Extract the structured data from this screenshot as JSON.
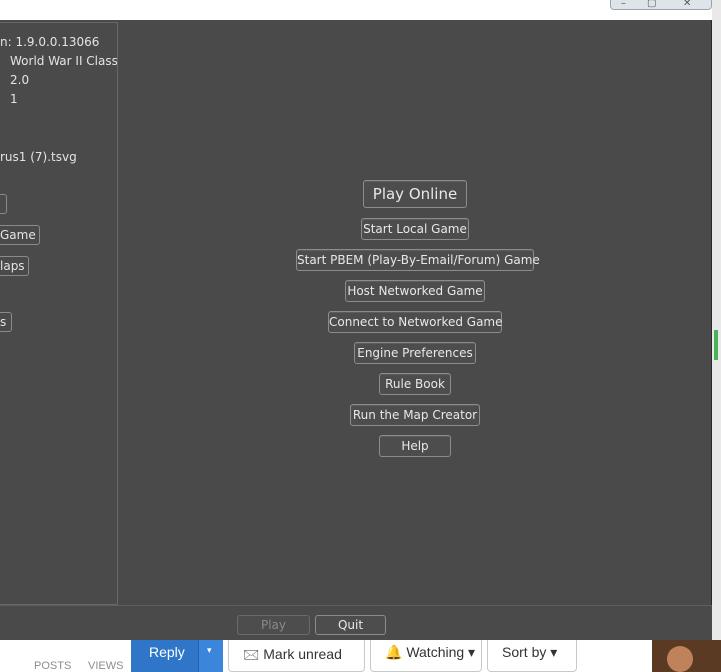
{
  "background": {
    "stats": [
      "POSTS",
      "VIEWS"
    ],
    "reply_label": "Reply",
    "reply_dropdown_glyph": "▾",
    "mark_unread_label": "🖂 Mark unread",
    "watching_label": "🔔 Watching ▾",
    "sort_by_label": "Sort by ▾",
    "window_controls": [
      "–",
      "▢",
      "✕"
    ]
  },
  "info": {
    "engine_version": "n:  1.9.0.0.13066",
    "game_name": "World War II Classic",
    "game_version": "2.0",
    "game_round": "1",
    "file_name": "rus1 (7).tsvg"
  },
  "left_buttons": {
    "button_1": "",
    "game_button": "Game",
    "maps_button": "laps",
    "options_button": "s"
  },
  "menu": {
    "play_online": "Play Online",
    "start_local_game": "Start Local Game",
    "start_pbem_game": "Start PBEM (Play-By-Email/Forum) Game",
    "host_networked_game": "Host Networked Game",
    "connect_networked_game": "Connect to Networked Game",
    "engine_preferences": "Engine Preferences",
    "rule_book": "Rule Book",
    "run_map_creator": "Run the Map Creator",
    "help": "Help"
  },
  "bottom": {
    "play": "Play",
    "quit": "Quit"
  }
}
